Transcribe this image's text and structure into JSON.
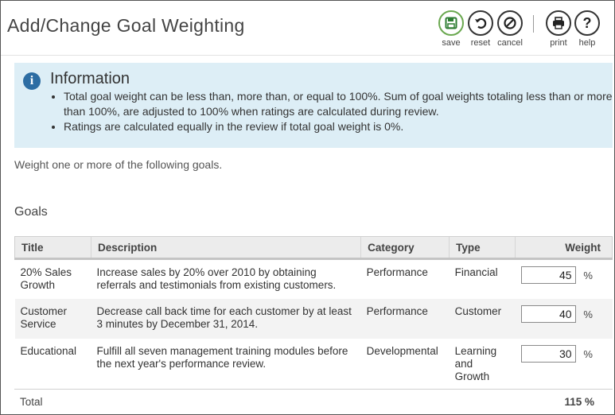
{
  "header": {
    "title": "Add/Change Goal Weighting",
    "toolbar": [
      {
        "id": "save",
        "label": "save",
        "icon": "floppy-disk-icon"
      },
      {
        "id": "reset",
        "label": "reset",
        "icon": "undo-icon"
      },
      {
        "id": "cancel",
        "label": "cancel",
        "icon": "cancel-icon"
      },
      {
        "id": "print",
        "label": "print",
        "icon": "printer-icon"
      },
      {
        "id": "help",
        "label": "help",
        "icon": "question-icon"
      }
    ]
  },
  "info": {
    "title": "Information",
    "bullets": [
      "Total goal weight can be less than, more than, or equal to 100%. Sum of goal weights totaling less than or more than 100%, are adjusted to 100% when ratings are calculated during review.",
      "Ratings are calculated equally in the review if total goal weight is 0%."
    ]
  },
  "intro": "Weight one or more of the following goals.",
  "section_title": "Goals",
  "table": {
    "headers": {
      "title": "Title",
      "description": "Description",
      "category": "Category",
      "type": "Type",
      "weight": "Weight"
    },
    "rows": [
      {
        "title": "20% Sales Growth",
        "description": "Increase sales by 20% over 2010 by obtaining referrals and testimonials from existing customers.",
        "category": "Performance",
        "type": "Financial",
        "weight": "45",
        "unit": "%"
      },
      {
        "title": "Customer Service",
        "description": "Decrease call back time for each customer by at least 3 minutes by December 31, 2014.",
        "category": "Performance",
        "type": "Customer",
        "weight": "40",
        "unit": "%"
      },
      {
        "title": "Educational",
        "description": "Fulfill all seven management training modules before the next year's performance review.",
        "category": "Developmental",
        "type": "Learning and Growth",
        "weight": "30",
        "unit": "%"
      }
    ],
    "total_label": "Total",
    "total_value": "115 %"
  },
  "colors": {
    "info_bg": "#ddeef6",
    "save_accent": "#6aa84f",
    "info_icon": "#2d6da3"
  }
}
